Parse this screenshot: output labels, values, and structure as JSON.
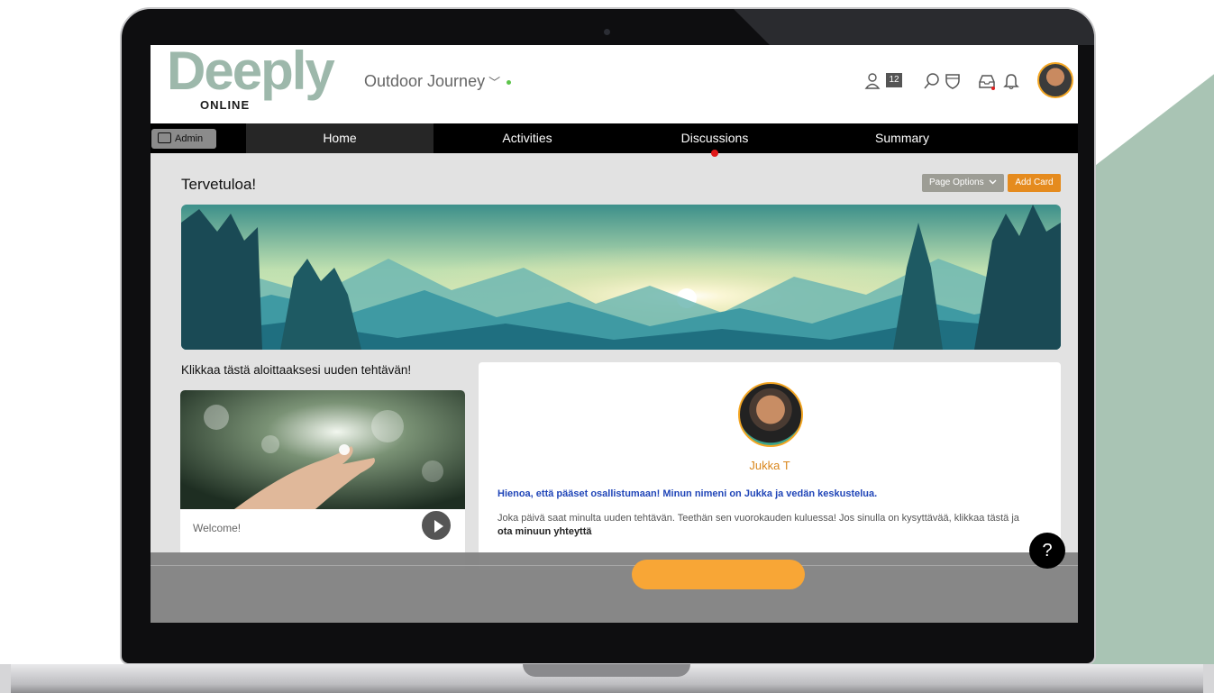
{
  "app": {
    "logo_text": "Deeply",
    "logo_subtitle": "ONLINE",
    "journey_name": "Outdoor Journey",
    "journey_chevron": "﹀",
    "participant_count": "12"
  },
  "icons": [
    "users-icon",
    "search-icon",
    "shield-icon",
    "inbox-icon",
    "bell-icon",
    "chevron-down-icon",
    "briefcase-icon",
    "play-icon",
    "help-icon"
  ],
  "colors": {
    "accent_orange": "#e58b1e",
    "brand_green": "#9db8ab",
    "nav_bg": "#000000",
    "link_blue": "#2146b8",
    "online_green": "#5cc44a",
    "alert_red": "#e01818"
  },
  "nav": {
    "admin_label": "Admin",
    "items": [
      {
        "label": "Home",
        "active": true
      },
      {
        "label": "Activities"
      },
      {
        "label": "Discussions",
        "has_alert": true
      },
      {
        "label": "Summary"
      }
    ]
  },
  "page": {
    "title": "Tervetuloa!",
    "page_options_label": "Page Options",
    "add_card_label": "Add Card",
    "start_label": "Klikkaa tästä aloittaaksesi uuden tehtävän!",
    "video_caption": "Welcome!"
  },
  "host": {
    "name": "Jukka T",
    "greeting": "Hienoa, että pääset osallistumaan! Minun nimeni on Jukka ja vedän keskustelua.",
    "body": "Joka päivä saat minulta uuden tehtävän. Teethän sen vuorokauden kuluessa! Jos sinulla on kysyttävää, klikkaa tästä ja",
    "body_bold": "ota minuun yhteyttä"
  },
  "help_label": "?"
}
